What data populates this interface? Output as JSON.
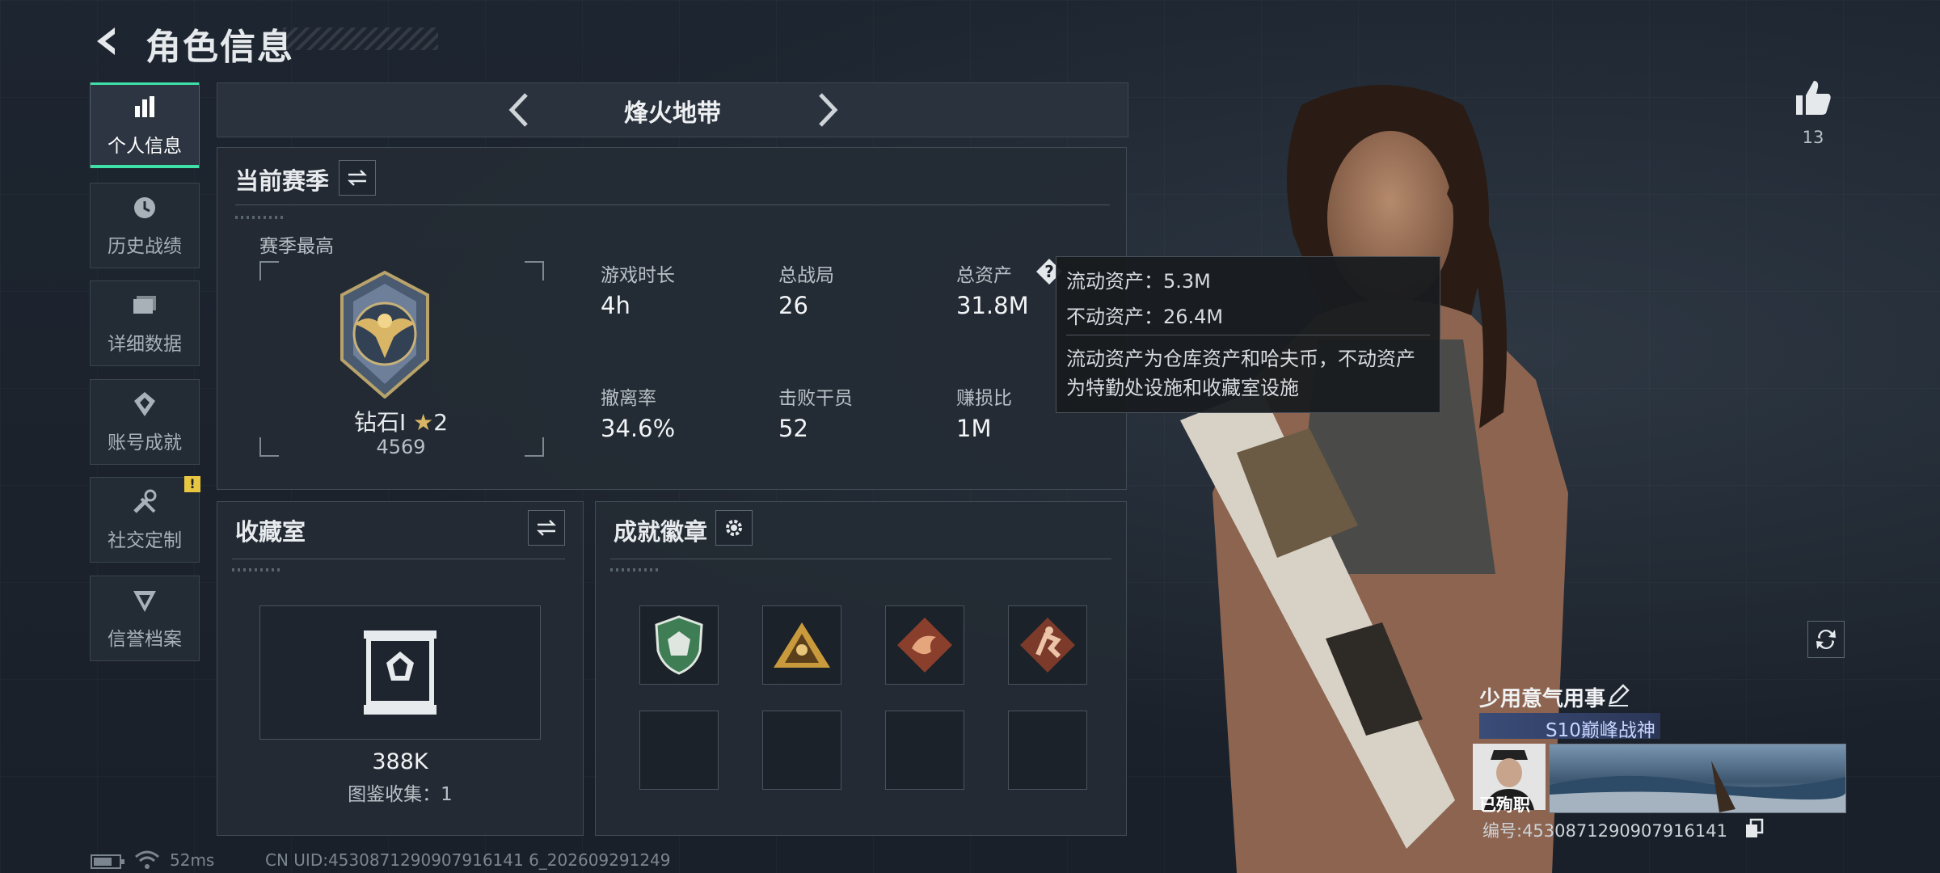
{
  "header": {
    "title": "角色信息"
  },
  "sidebar": {
    "items": [
      {
        "label": "个人信息",
        "icon": "bar-chart-icon",
        "active": true
      },
      {
        "label": "历史战绩",
        "icon": "history-icon",
        "active": false
      },
      {
        "label": "详细数据",
        "icon": "folder-icon",
        "active": false
      },
      {
        "label": "账号成就",
        "icon": "achievement-icon",
        "active": false
      },
      {
        "label": "社交定制",
        "icon": "tools-icon",
        "active": false,
        "badge": "!"
      },
      {
        "label": "信誉档案",
        "icon": "reputation-icon",
        "active": false
      }
    ]
  },
  "mode": {
    "title": "烽火地带"
  },
  "season": {
    "title": "当前赛季",
    "best_label": "赛季最高",
    "rank_name": "钻石Ⅰ",
    "rank_stars": "2",
    "rank_score": "4569",
    "stats": [
      {
        "label": "游戏时长",
        "value": "4h"
      },
      {
        "label": "总战局",
        "value": "26"
      },
      {
        "label": "总资产",
        "value": "31.8M"
      },
      {
        "label": "撤离率",
        "value": "34.6%"
      },
      {
        "label": "击败干员",
        "value": "52"
      },
      {
        "label": "赚损比",
        "value": "1M"
      }
    ]
  },
  "tooltip": {
    "liquid": "流动资产：5.3M",
    "fixed": "不动资产：26.4M",
    "desc_line1": "流动资产为仓库资产和哈夫币，不动资产",
    "desc_line2": "为特勤处设施和收藏室设施"
  },
  "collection": {
    "title": "收藏室",
    "value": "388K",
    "catalog": "图鉴收集：1"
  },
  "badges": {
    "title": "成就徽章",
    "items": [
      "shield-badge-icon",
      "pyramid-badge-icon",
      "dragon-badge-icon",
      "climber-badge-icon"
    ]
  },
  "profile": {
    "likes": "13",
    "player_name": "少用意气用事",
    "season_tag": "S10巅峰战神",
    "status": "已殉职",
    "id_line": "编号:4530871290907916141"
  },
  "footer": {
    "ping": "52ms",
    "uid": "CN UID:4530871290907916141 6_202609291249"
  },
  "colors": {
    "accent": "#3fe0a8",
    "badge": "#e9c641",
    "background": "#1b222b"
  }
}
